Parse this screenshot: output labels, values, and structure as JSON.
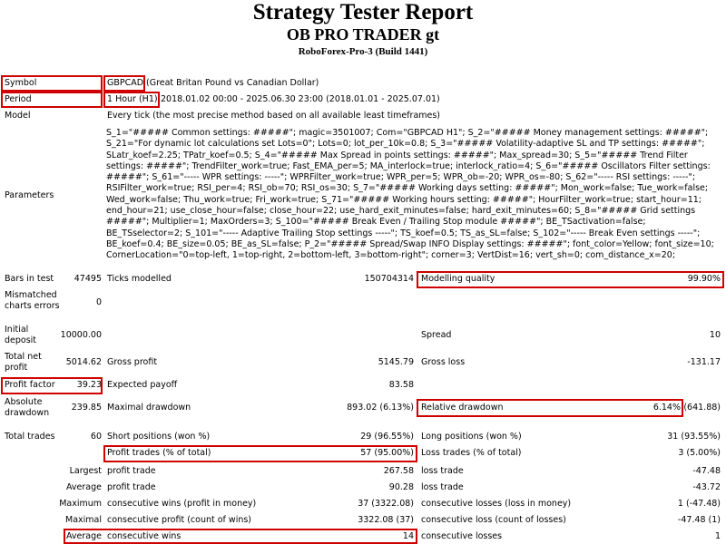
{
  "header": {
    "title": "Strategy Tester Report",
    "expert": "OB PRO TRADER gt",
    "build": "RoboForex-Pro-3 (Build 1441)"
  },
  "rows": {
    "symbol_label": "Symbol",
    "symbol_code": "GBPCAD",
    "symbol_desc": "(Great Britan Pound vs Canadian Dollar)",
    "period_label": "Period",
    "period_tf": "1 Hour (H1)",
    "period_range": "2018.01.02 00:00 - 2025.06.30 23:00 (2018.01.01 - 2025.07.01)",
    "model_label": "Model",
    "model_value": "Every tick (the most precise method based on all available least timeframes)",
    "parameters_label": "Parameters",
    "parameters_text": "S_1=\"##### Common settings: #####\"; magic=3501007; Com=\"GBPCAD H1\"; S_2=\"##### Money management settings: #####\"; S_21=\"For dynamic lot calculations set Lots=0\"; Lots=0; lot_per_10k=0.8; S_3=\"##### Volatility-adaptive SL and TP settings: #####\"; SLatr_koef=2.25; TPatr_koef=0.5; S_4=\"##### Max Spread in points settings: #####\"; Max_spread=30; S_5=\"##### Trend Filter settings: #####\"; TrendFilter_work=true; Fast_EMA_per=5; MA_interlock=true; interlock_ratio=4; S_6=\"##### Oscillators Filter settings: #####\"; S_61=\"----- WPR settings: -----\"; WPRFilter_work=true; WPR_per=5; WPR_ob=-20; WPR_os=-80; S_62=\"----- RSI settings: -----\"; RSIFilter_work=true; RSI_per=4; RSI_ob=70; RSI_os=30; S_7=\"##### Working days setting: #####\"; Mon_work=false; Tue_work=false; Wed_work=false; Thu_work=true; Fri_work=true; S_71=\"##### Working hours setting: #####\"; HourFilter_work=true; start_hour=11; end_hour=21; use_close_hour=false; close_hour=22; use_hard_exit_minutes=false; hard_exit_minutes=60; S_8=\"##### Grid settings #####\"; Multiplier=1; MaxOrders=3; S_100=\"##### Break Even / Trailing Stop module #####\"; BE_TSactivation=false; BE_TSselector=2; S_101=\"----- Adaptive Trailing Stop settings -----\"; TS_koef=0.5; TS_as_SL=false; S_102=\"----- Break Even settings -----\"; BE_koef=0.4; BE_size=0.05; BE_as_SL=false; P_2=\"##### Spread/Swap INFO Display settings: #####\"; font_color=Yellow; font_size=10; CornerLocation=\"0=top-left, 1=top-right, 2=bottom-left, 3=bottom-right\"; corner=3; VertDist=16; vert_sh=0; com_distance_x=20;"
  },
  "stats": {
    "bars_label": "Bars in test",
    "bars_value": "47495",
    "ticks_label": "Ticks modelled",
    "ticks_value": "150704314",
    "mq_label": "Modelling quality",
    "mq_value": "99.90%",
    "mismatch_label": "Mismatched charts errors",
    "mismatch_value": "0",
    "deposit_label": "Initial deposit",
    "deposit_value": "10000.00",
    "spread_label": "Spread",
    "spread_value": "10",
    "tnp_label": "Total net profit",
    "tnp_value": "5014.62",
    "gp_label": "Gross profit",
    "gp_value": "5145.79",
    "gl_label": "Gross loss",
    "gl_value": "-131.17",
    "pf_label": "Profit factor",
    "pf_value": "39.23",
    "ep_label": "Expected payoff",
    "ep_value": "83.58",
    "ad_label": "Absolute drawdown",
    "ad_value": "239.85",
    "md_label": "Maximal drawdown",
    "md_value": "893.02 (6.13%)",
    "rd_label": "Relative drawdown",
    "rd_pct": "6.14%",
    "rd_money": "(641.88)",
    "tt_label": "Total trades",
    "tt_value": "60",
    "sp_label": "Short positions (won %)",
    "sp_value": "29 (96.55%)",
    "lp_label": "Long positions (won %)",
    "lp_value": "31 (93.55%)",
    "pt_label": "Profit trades (% of total)",
    "pt_value": "57 (95.00%)",
    "lt_label": "Loss trades (% of total)",
    "lt_value": "3 (5.00%)",
    "largest_label": "Largest",
    "lpt_label": "profit trade",
    "lpt_value": "267.58",
    "llt_label": "loss trade",
    "llt_value": "-47.48",
    "average_label": "Average",
    "apt_label": "profit trade",
    "apt_value": "90.28",
    "alt_label": "loss trade",
    "alt_value": "-43.72",
    "maximum_label": "Maximum",
    "mcw_label": "consecutive wins (profit in money)",
    "mcw_value": "37 (3322.08)",
    "mcl_label": "consecutive losses (loss in money)",
    "mcl_value": "1 (-47.48)",
    "maximal_label": "Maximal",
    "mcp_label": "consecutive profit (count of wins)",
    "mcp_value": "3322.08 (37)",
    "mcls_label": "consecutive loss (count of losses)",
    "mcls_value": "-47.48 (1)",
    "average2_label": "Average",
    "acw_label": "consecutive wins",
    "acw_value": "14",
    "acl_label": "consecutive losses",
    "acl_value": "1"
  },
  "highlight_color": "#d00000"
}
